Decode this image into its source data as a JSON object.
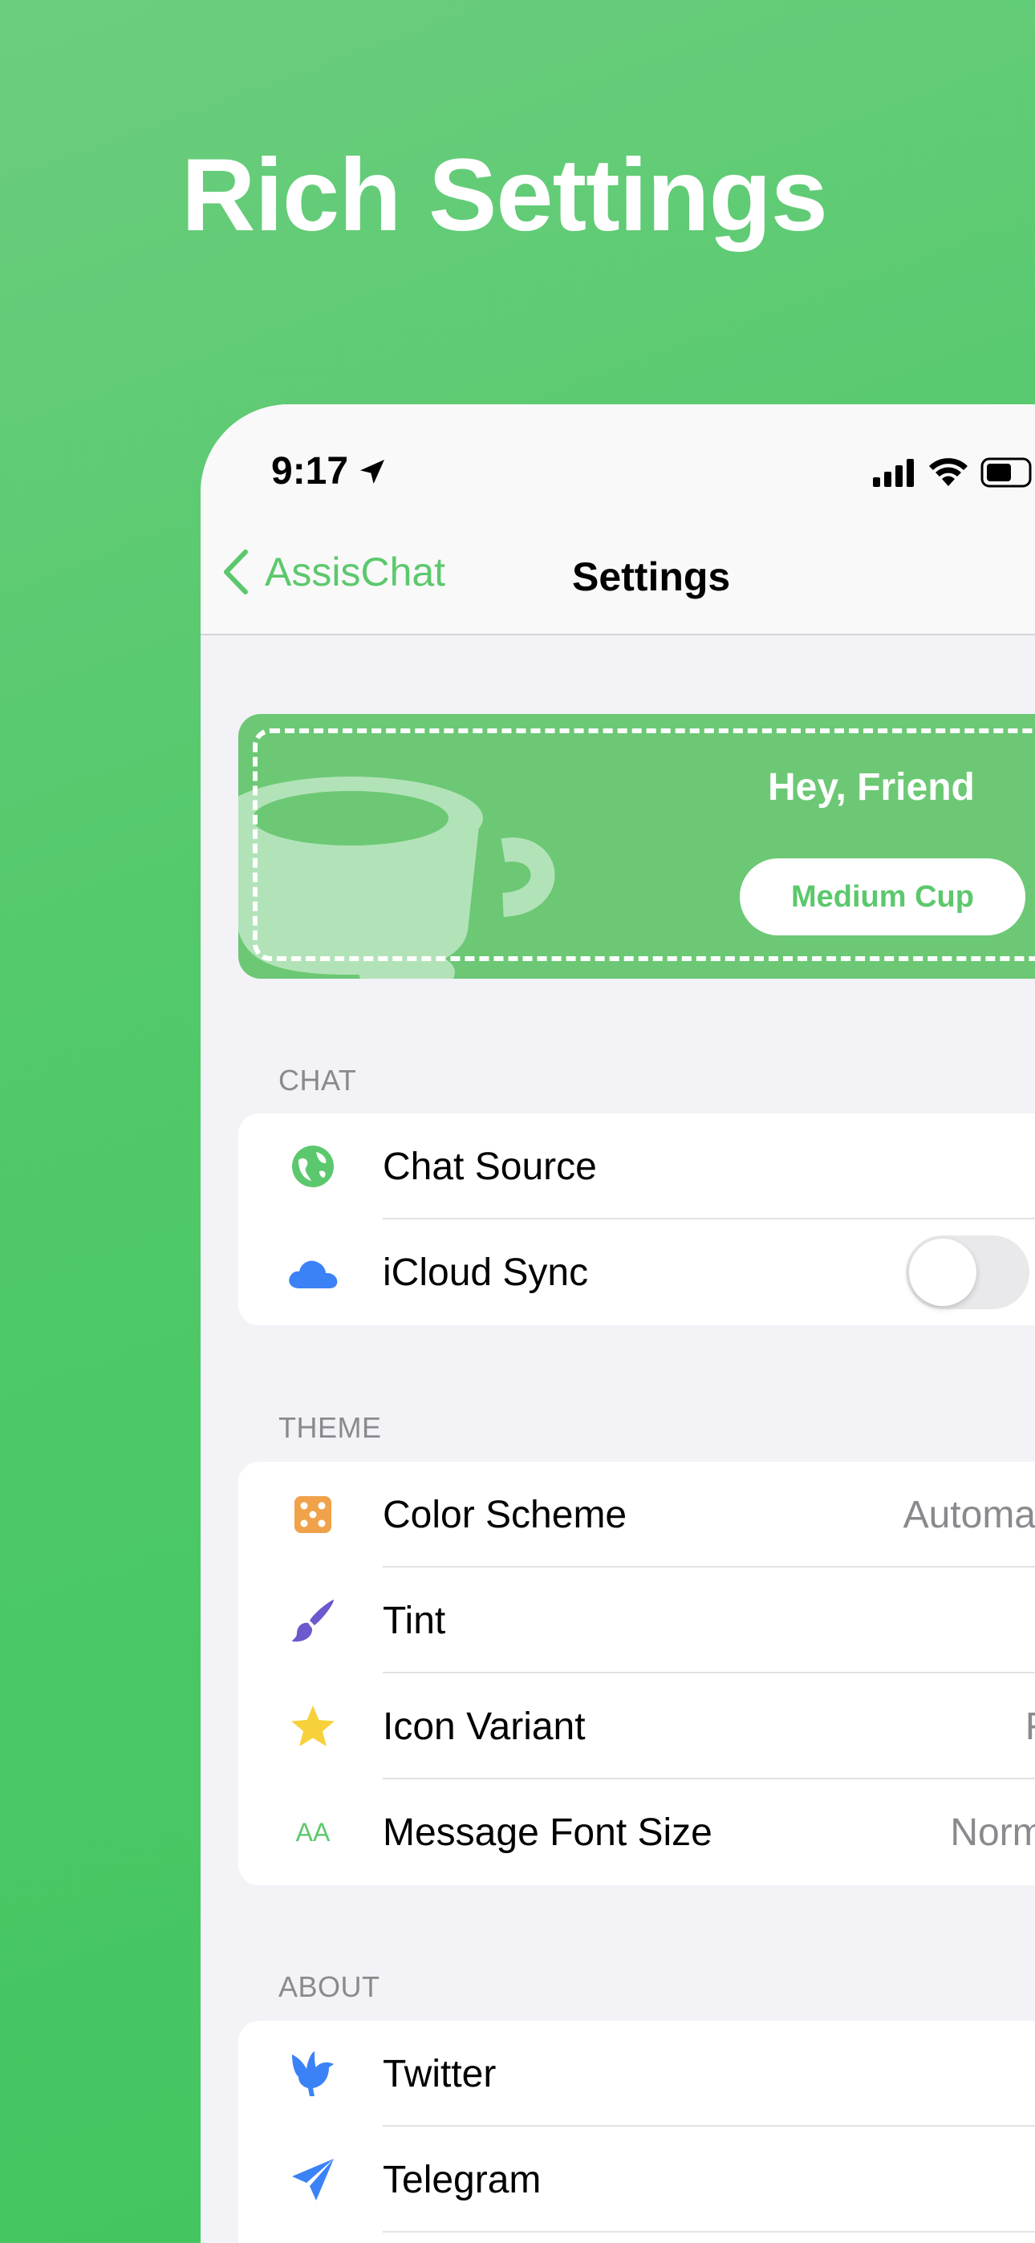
{
  "headline": "Rich Settings",
  "status_bar": {
    "time": "9:17"
  },
  "nav": {
    "back_label": "AssisChat",
    "title": "Settings"
  },
  "banner": {
    "greeting": "Hey, Friend",
    "button_label": "Medium Cup"
  },
  "sections": {
    "chat": {
      "header": "CHAT",
      "rows": [
        {
          "label": "Chat Source",
          "icon": "globe-icon"
        },
        {
          "label": "iCloud Sync",
          "icon": "cloud-icon",
          "toggle_on": false
        }
      ]
    },
    "theme": {
      "header": "THEME",
      "rows": [
        {
          "label": "Color Scheme",
          "value": "Automatic",
          "icon": "dice-icon"
        },
        {
          "label": "Tint",
          "icon": "paintbrush-icon"
        },
        {
          "label": "Icon Variant",
          "value": "Fill",
          "icon": "star-icon"
        },
        {
          "label": "Message Font Size",
          "value": "Normal",
          "icon": "textformat-size-icon",
          "icon_text": "AA"
        }
      ]
    },
    "about": {
      "header": "ABOUT",
      "rows": [
        {
          "label": "Twitter",
          "icon": "bird-icon"
        },
        {
          "label": "Telegram",
          "icon": "paperplane-icon"
        }
      ]
    }
  },
  "colors": {
    "accent": "#5cc86d",
    "background_top": "#6ccd7e",
    "background_bottom": "#3fc55e",
    "banner": "#6cc874",
    "cloud_blue": "#3b82f6",
    "dice_orange": "#f0a24a",
    "brush_purple": "#6a5acd",
    "star_yellow": "#f7d13b"
  }
}
